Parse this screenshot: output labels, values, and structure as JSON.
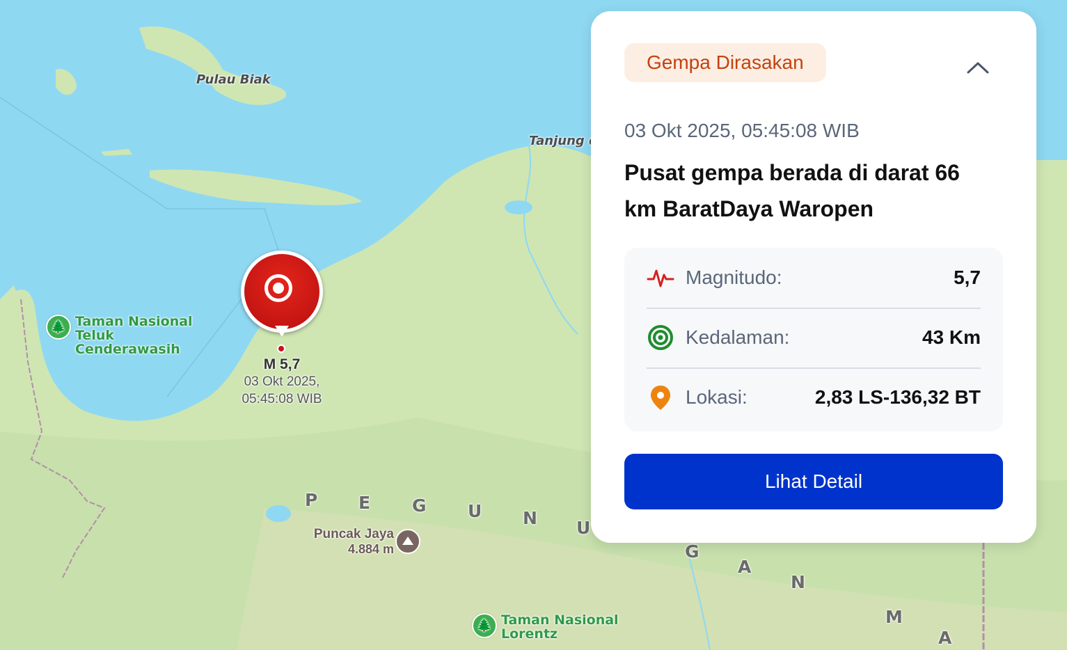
{
  "map": {
    "labels": {
      "pulau_biak": "Pulau Biak",
      "tanjung": "Tanjung d",
      "park_teluk": "Taman Nasional\nTeluk\nCenderawasih",
      "park_lorentz": "Taman Nasional\nLorentz",
      "peak_name": "Puncak Jaya",
      "peak_elevation": "4.884 m",
      "range_letters": [
        "P",
        "E",
        "G",
        "U",
        "N",
        "U",
        "G",
        "A",
        "N",
        "M",
        "A"
      ]
    },
    "marker": {
      "magnitude_label": "M 5,7",
      "datetime_label_line1": "03 Okt 2025,",
      "datetime_label_line2": "05:45:08 WIB",
      "color": "#d01a1a"
    }
  },
  "card": {
    "badge": "Gempa Dirasakan",
    "badge_color": "#c4420f",
    "collapse_icon": "chevron-up-icon",
    "timestamp": "03 Okt 2025, 05:45:08 WIB",
    "headline": "Pusat gempa berada di darat 66 km BaratDaya Waropen",
    "rows": [
      {
        "icon": "pulse-icon",
        "label": "Magnitudo:",
        "value": "5,7"
      },
      {
        "icon": "target-icon",
        "label": "Kedalaman:",
        "value": "43 Km"
      },
      {
        "icon": "location-pin-icon",
        "label": "Lokasi:",
        "value": "2,83 LS-136,32 BT"
      }
    ],
    "button_label": "Lihat Detail",
    "button_color": "#0033cc"
  }
}
